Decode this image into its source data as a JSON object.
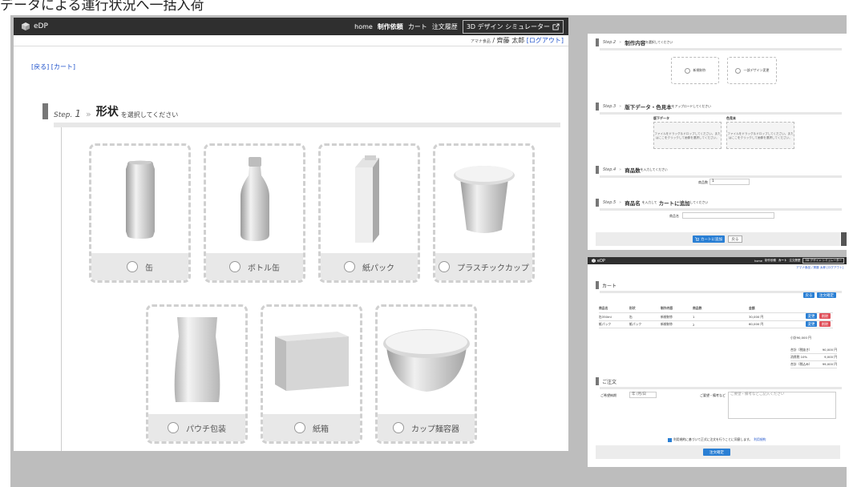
{
  "caption": "データによる運行状況へ一括入荷",
  "main": {
    "nav": {
      "brand": "eDP",
      "links": [
        "home",
        "制作依頼",
        "カート",
        "注文履歴"
      ],
      "active": "制作依頼",
      "simulator": "3D デザイン シミュレーター"
    },
    "user": {
      "company": "アマナ食品",
      "sep": " / ",
      "name": "齊藤 太郎",
      "logout": "[ログアウト]"
    },
    "crumbs": {
      "back": "[戻る]",
      "cart": "[カート]"
    },
    "step1": {
      "label": "Step.",
      "num": "1",
      "arrow": "»",
      "title": "形状",
      "suffix": "を選択してください"
    },
    "shapes": [
      "缶",
      "ボトル缶",
      "紙パック",
      "プラスチックカップ",
      "パウチ包装",
      "紙箱",
      "カップ麺容器"
    ]
  },
  "panel_top": {
    "step2": {
      "label": "Step.",
      "num": "2",
      "arrow": "»",
      "title": "制作内容",
      "suffix": "を選択してください"
    },
    "step2_options": [
      "新規制作",
      "一部デザイン変更"
    ],
    "step3": {
      "label": "Step.",
      "num": "3",
      "arrow": "»",
      "title": "版下データ・色見本",
      "suffix": "をアップロードしてください"
    },
    "upload1": {
      "title": "版下データ",
      "text": "ファイルをドラッグ＆ドロップしてください。またはここをクリックして画像を選択してください。"
    },
    "upload2": {
      "title": "色見本",
      "text": "ファイルをドラッグ＆ドロップしてください。またはここをクリックして画像を選択してください。"
    },
    "step4": {
      "label": "Step.",
      "num": "4",
      "arrow": "»",
      "title": "商品数",
      "suffix": "を入力してください"
    },
    "qty_label": "商品数",
    "qty_value": "1",
    "step5": {
      "label": "Step.",
      "num": "5",
      "arrow": "»",
      "title": "商品名",
      "mid": "を入力して",
      "title2": "カートに追加",
      "suffix": "してください"
    },
    "name_label": "商品名",
    "add_button": "カートに追加",
    "back_button": "戻る"
  },
  "panel_bottom": {
    "nav": {
      "brand": "eDP",
      "links": [
        "home",
        "制作依頼",
        "カート",
        "注文履歴"
      ],
      "simulator": "3D デザイン シミュレーター"
    },
    "user": "アマナ食品 / 齊藤 太郎 [ログアウト]",
    "cart_title": "カート",
    "top_buttons": [
      "戻る",
      "注文確定"
    ],
    "headers": [
      "商品名",
      "形状",
      "制作内容",
      "商品数",
      "金額"
    ],
    "rows": [
      {
        "name": "缶350ml",
        "shape": "缶",
        "kind": "新規制作",
        "qty": "1",
        "price": "30,000 円"
      },
      {
        "name": "紙パック",
        "shape": "紙パック",
        "kind": "新規制作",
        "qty": "2",
        "price": "60,000 円"
      }
    ],
    "row_buttons": [
      "変更",
      "削除"
    ],
    "summary": [
      {
        "k": "小計",
        "v": "90,000 円"
      },
      {
        "k": "合計（税抜き）",
        "v": "90,000 円"
      },
      {
        "k": "消費税 10%",
        "v": "9,000 円"
      },
      {
        "k": "合計（税込み）",
        "v": "99,000 円"
      }
    ],
    "order_title": "ご注文",
    "date_label": "ご希望納期",
    "date_placeholder": "年 /月/日",
    "note_label": "ご要望・備考など",
    "note_placeholder": "ご要望・備考などご記入ください",
    "agree_text": "利用規約に基づいて正式に注文を行うことに同意します。",
    "terms_link": "利用規約",
    "order_button": "注文確定"
  },
  "colors": {
    "nav": "#2f2f2f",
    "blue": "#2a7fd4",
    "red": "#e0505a",
    "link": "#2255cc"
  }
}
